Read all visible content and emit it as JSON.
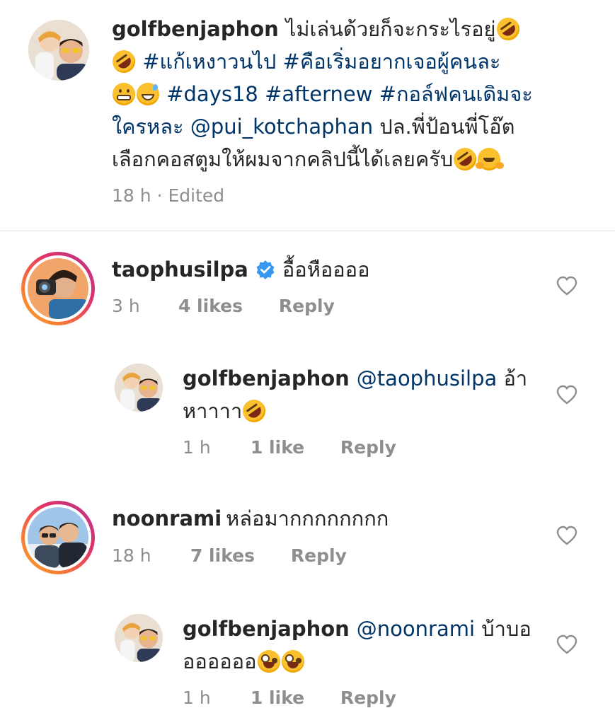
{
  "caption": {
    "username": "golfbenjaphon",
    "text_1": "ไม่เล่นด้วยก็จะกระไรอยู่",
    "text_2": "#แก้เหงาวนไป #คือเริ่มอยากเจอผู้คนละ",
    "text_3": "#days18 #afternew #กอล์ฟคนเดิมจะ",
    "text_4": "ใครหละ",
    "mention": "@pui_kotchaphan",
    "text_5": "ปล.พี่ป้อนพี่โอ๊ต",
    "text_6": "เลือกคอสตูมให้ผมจากคลิปนี้ได้เลยครับ",
    "time": "18 h",
    "edited": "· Edited"
  },
  "comments": [
    {
      "username": "taophusilpa",
      "verified": true,
      "text": "อื้อหืออออ",
      "time": "3 h",
      "likes": "4 likes",
      "reply_label": "Reply"
    },
    {
      "username": "golfbenjaphon",
      "mention": "@taophusilpa",
      "text_1": "อ้า",
      "text_2": "หาาาา",
      "time": "1 h",
      "likes": "1 like",
      "reply_label": "Reply"
    },
    {
      "username": "noonrami",
      "text": "หล่อมากกกกกกกก",
      "time": "18 h",
      "likes": "7 likes",
      "reply_label": "Reply"
    },
    {
      "username": "golfbenjaphon",
      "mention": "@noonrami",
      "text_1": "บ้าบอ",
      "text_2": "ออออออ",
      "time": "1 h",
      "likes": "1 like",
      "reply_label": "Reply"
    }
  ],
  "icons": {
    "like": "heart-outline-icon",
    "verified": "verified-badge-icon"
  },
  "colors": {
    "text": "#262626",
    "secondary": "#8e8e8e",
    "link": "#003569",
    "verified": "#3897f0",
    "story_ring_start": "#f9a825",
    "story_ring_end": "#c13584"
  }
}
